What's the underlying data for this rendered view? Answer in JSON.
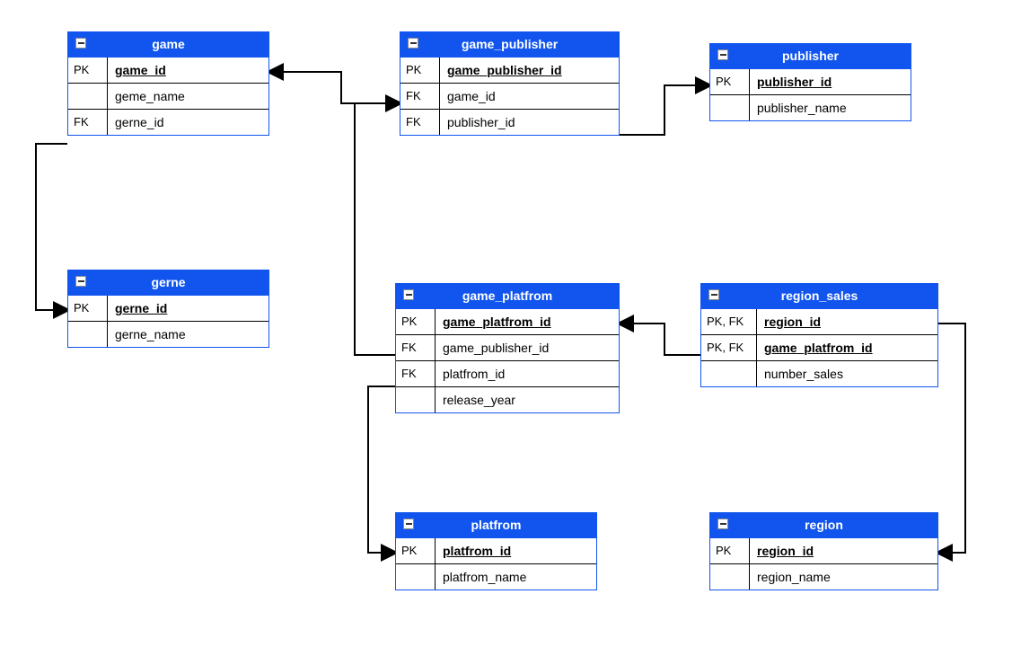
{
  "entities": {
    "game": {
      "title": "game",
      "rows": [
        {
          "key": "PK",
          "name": "game_id",
          "pk": true
        },
        {
          "key": "",
          "name": "geme_name"
        },
        {
          "key": "FK",
          "name": "gerne_id"
        }
      ]
    },
    "game_publisher": {
      "title": "game_publisher",
      "rows": [
        {
          "key": "PK",
          "name": "game_publisher_id",
          "pk": true
        },
        {
          "key": "FK",
          "name": "game_id"
        },
        {
          "key": "FK",
          "name": "publisher_id"
        }
      ]
    },
    "publisher": {
      "title": "publisher",
      "rows": [
        {
          "key": "PK",
          "name": "publisher_id",
          "pk": true
        },
        {
          "key": "",
          "name": "publisher_name"
        }
      ]
    },
    "gerne": {
      "title": "gerne",
      "rows": [
        {
          "key": "PK",
          "name": "gerne_id",
          "pk": true
        },
        {
          "key": "",
          "name": "gerne_name"
        }
      ]
    },
    "game_platfrom": {
      "title": "game_platfrom",
      "rows": [
        {
          "key": "PK",
          "name": "game_platfrom_id",
          "pk": true
        },
        {
          "key": "FK",
          "name": "game_publisher_id"
        },
        {
          "key": "FK",
          "name": "platfrom_id"
        },
        {
          "key": "",
          "name": "release_year"
        }
      ]
    },
    "region_sales": {
      "title": "region_sales",
      "rows": [
        {
          "key": "PK, FK",
          "name": "region_id",
          "pk": true
        },
        {
          "key": "PK, FK",
          "name": "game_platfrom_id",
          "pk": true
        },
        {
          "key": "",
          "name": "number_sales"
        }
      ]
    },
    "platfrom": {
      "title": "platfrom",
      "rows": [
        {
          "key": "PK",
          "name": "platfrom_id",
          "pk": true
        },
        {
          "key": "",
          "name": "platfrom_name"
        }
      ]
    },
    "region": {
      "title": "region",
      "rows": [
        {
          "key": "PK",
          "name": "region_id",
          "pk": true
        },
        {
          "key": "",
          "name": "region_name"
        }
      ]
    }
  },
  "relationships": [
    {
      "from": "game.gerne_id",
      "to": "gerne.gerne_id"
    },
    {
      "from": "game_publisher.game_id",
      "to": "game.game_id"
    },
    {
      "from": "game_publisher.publisher_id",
      "to": "publisher.publisher_id"
    },
    {
      "from": "game_platfrom.game_publisher_id",
      "to": "game_publisher.game_publisher_id"
    },
    {
      "from": "game_platfrom.platfrom_id",
      "to": "platfrom.platfrom_id"
    },
    {
      "from": "region_sales.game_platfrom_id",
      "to": "game_platfrom.game_platfrom_id"
    },
    {
      "from": "region_sales.region_id",
      "to": "region.region_id"
    }
  ]
}
